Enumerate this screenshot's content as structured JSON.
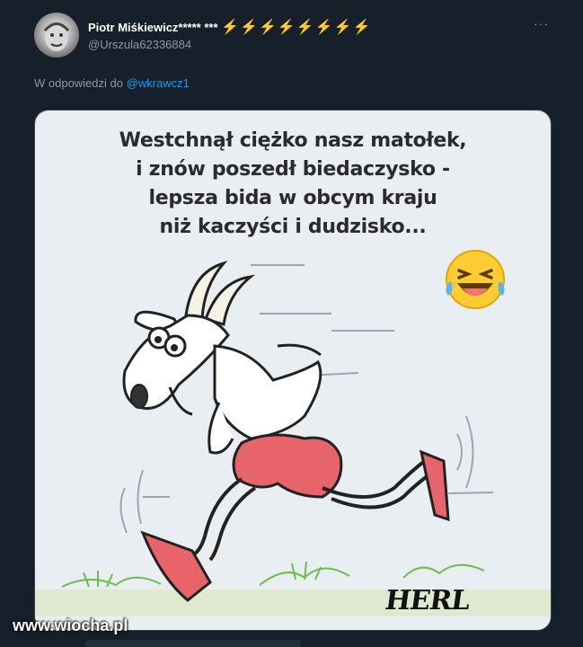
{
  "tweet": {
    "author_name": "Piotr Miśkiewicz***** ***",
    "author_badges": "⚡⚡⚡⚡⚡⚡⚡⚡",
    "handle": "@Urszula62336884",
    "more_label": "···",
    "reply_prefix": "W odpowiedzi do",
    "reply_mention": "@wkrawcz1"
  },
  "media": {
    "caption_lines": [
      "Westchnął  ciężko  nasz matołek,",
      "i znów poszedł biedaczysko -",
      "lepsza bida w obcym kraju",
      "niż kaczyści i dudzisko..."
    ],
    "signature": "HERL",
    "emoji": "laughing-tears-emoji"
  },
  "watermark": "www.wiocha.pl",
  "colors": {
    "background": "#15202b",
    "accent": "#1d9bf0",
    "shorts": "#e8646b"
  }
}
